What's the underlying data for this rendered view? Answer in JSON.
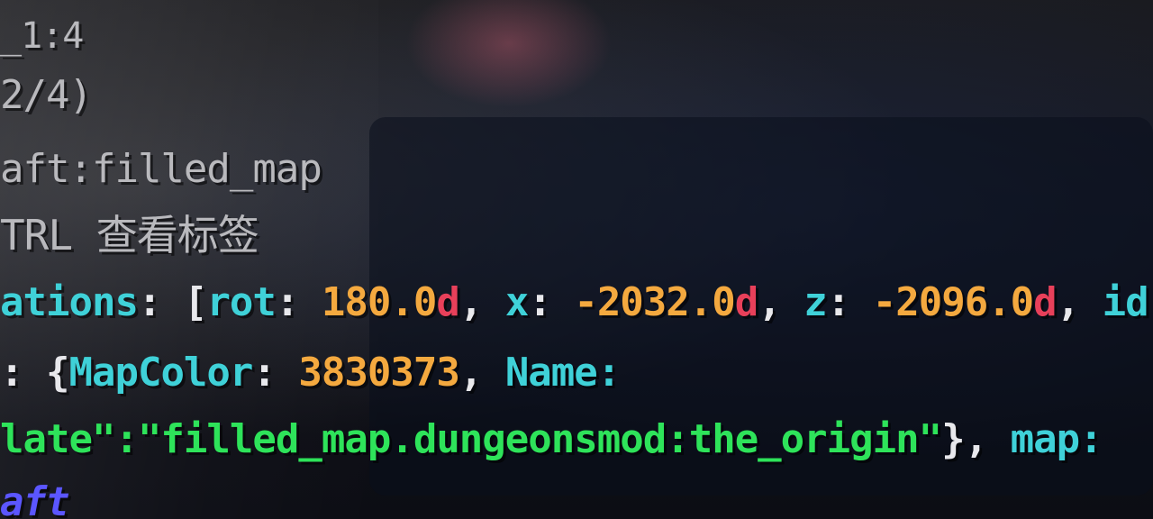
{
  "tooltip": {
    "line1": "_1:4",
    "line2": "2/4)",
    "line3": "aft:filled_map",
    "line4": "TRL 查看标签",
    "line5": {
      "key": "ations",
      "colon": ": ",
      "bracket": "[",
      "rot_key": "rot",
      "rot_colon": ": ",
      "rot_value": "180.0",
      "rot_suffix": "d",
      "sep1": ", ",
      "x_key": "x",
      "x_colon": ": ",
      "x_value": "-2032.0",
      "x_suffix": "d",
      "sep2": ", ",
      "z_key": "z",
      "z_colon": ": ",
      "z_value": "-2096.0",
      "z_suffix": "d",
      "sep3": ", ",
      "id_key": "id:"
    },
    "line6": {
      "prefix": ": ",
      "brace": "{",
      "mapcolor_key": "MapColor",
      "mapcolor_colon": ": ",
      "mapcolor_value": "3830373",
      "sep": ", ",
      "name_key": "Name:"
    },
    "line7": {
      "string": "late\":\"filled_map.dungeonsmod:the_origin\"",
      "close": "}",
      "sep": ", ",
      "map_key": "map:"
    },
    "line8": "aft"
  },
  "colors": {
    "key": "#3fd1d8",
    "number": "#f4a93f",
    "suffix": "#e8405a",
    "string": "#2ee35a",
    "plain": "#b9b9bd",
    "mod": "#5b56ff"
  }
}
